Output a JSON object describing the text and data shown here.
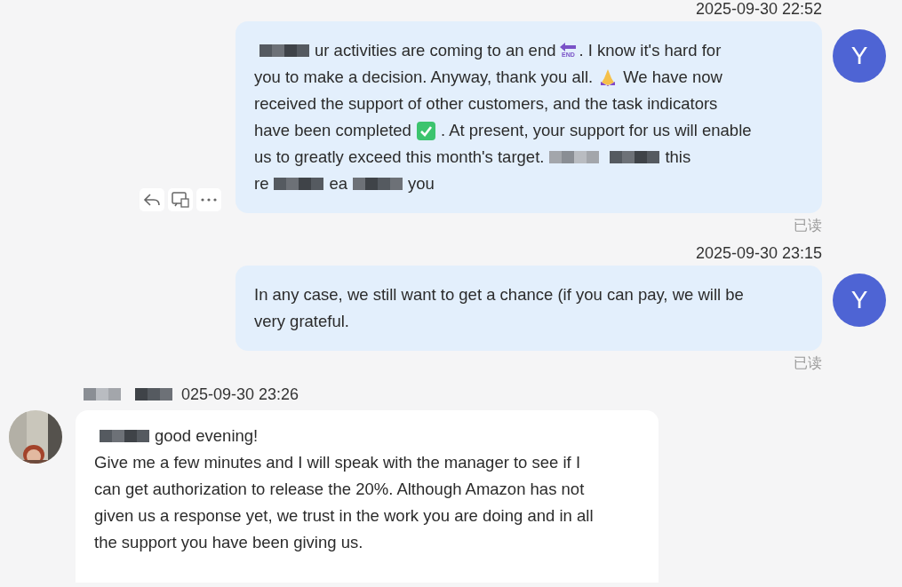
{
  "messages": [
    {
      "kind": "outgoing",
      "time": "2025-09-30 22:52",
      "avatar": "Y",
      "actions": true,
      "read": "已读",
      "lines": [
        [
          {
            "kind": "redaction"
          },
          {
            "kind": "text",
            "text": "ur activities are coming to an end"
          },
          {
            "kind": "end-sign",
            "text": "END"
          },
          {
            "kind": "text",
            "text": ". I know it's hard for"
          }
        ],
        [
          {
            "kind": "text",
            "text": "you to make a decision. Anyway, thank you all."
          },
          {
            "kind": "pray"
          },
          {
            "kind": "text",
            "text": "We have now"
          }
        ],
        [
          {
            "kind": "text",
            "text": "received the support of other customers, and the task indicators"
          }
        ],
        [
          {
            "kind": "text",
            "text": "have been completed"
          },
          {
            "kind": "check"
          },
          {
            "kind": "text",
            "text": ". At present, your support for us will enable"
          }
        ],
        [
          {
            "kind": "text",
            "text": "us to greatly exceed this month's target."
          },
          {
            "kind": "redaction"
          },
          {
            "kind": "redaction"
          },
          {
            "kind": "text",
            "text": "this"
          }
        ],
        [
          {
            "kind": "text",
            "text": "re"
          },
          {
            "kind": "redaction"
          },
          {
            "kind": "text",
            "text": "ea"
          },
          {
            "kind": "redaction"
          },
          {
            "kind": "text",
            "text": "you"
          }
        ]
      ]
    },
    {
      "kind": "outgoing",
      "time": "2025-09-30 23:15",
      "avatar": "Y",
      "actions": false,
      "read": "已读",
      "lines": [
        [
          {
            "kind": "text",
            "text": "In any case, we still want to get a chance (if you can pay, we will be"
          }
        ],
        [
          {
            "kind": "text",
            "text": "very grateful."
          }
        ]
      ]
    },
    {
      "kind": "incoming",
      "time": "025-09-30 23:26",
      "actions": false,
      "lines": [
        [
          {
            "kind": "redaction"
          },
          {
            "kind": "text",
            "text": "good evening!"
          }
        ],
        [
          {
            "kind": "text",
            "text": "Give me a few minutes and I will speak with the manager to see if I"
          }
        ],
        [
          {
            "kind": "text",
            "text": "can get authorization to release the 20%. Although Amazon has not"
          }
        ],
        [
          {
            "kind": "text",
            "text": "given us a response yet, we trust in the work you are doing and in all"
          }
        ],
        [
          {
            "kind": "text",
            "text": "the support you have been giving us."
          }
        ]
      ]
    }
  ]
}
